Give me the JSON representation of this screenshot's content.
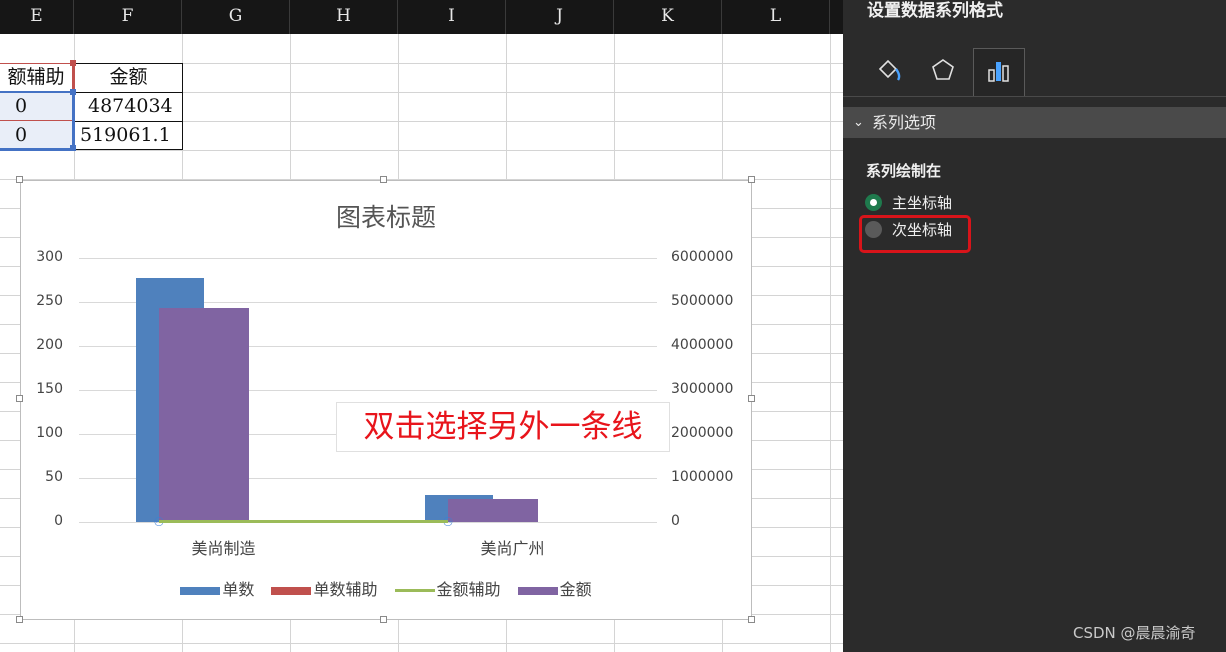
{
  "columns": [
    "E",
    "F",
    "G",
    "H",
    "I",
    "J",
    "K",
    "L"
  ],
  "table": {
    "headers": [
      "额辅助",
      "金额"
    ],
    "rows": [
      [
        "0",
        "4874034"
      ],
      [
        "0",
        "519061.1"
      ]
    ]
  },
  "chart": {
    "title": "图表标题",
    "annotation": "双击选择另外一条线"
  },
  "chart_data": {
    "type": "bar",
    "title": "图表标题",
    "categories": [
      "美尚制造",
      "美尚广州"
    ],
    "y_left": {
      "ticks": [
        "300",
        "250",
        "200",
        "150",
        "100",
        "50",
        "0"
      ],
      "range": [
        0,
        300
      ]
    },
    "y_right": {
      "ticks": [
        "6000000",
        "5000000",
        "4000000",
        "3000000",
        "2000000",
        "1000000",
        "0"
      ],
      "range": [
        0,
        6000000
      ]
    },
    "series": [
      {
        "name": "单数",
        "axis": "left",
        "values": [
          277,
          31
        ],
        "color": "#4f81bd"
      },
      {
        "name": "单数辅助",
        "axis": "left",
        "values": [
          0,
          0
        ],
        "color": "#c0504d"
      },
      {
        "name": "金额辅助",
        "axis": "left",
        "values": [
          0,
          0
        ],
        "color": "#9bbb59"
      },
      {
        "name": "金额",
        "axis": "right",
        "values": [
          4874034,
          519061.1
        ],
        "color": "#8064a2"
      }
    ],
    "legend": "bottom"
  },
  "panel": {
    "title": "设置数据系列格式",
    "section": "系列选项",
    "plot_on_label": "系列绘制在",
    "options": [
      {
        "label": "主坐标轴",
        "selected": true
      },
      {
        "label": "次坐标轴",
        "selected": false
      }
    ],
    "icons": [
      "fill-line-icon",
      "effects-icon",
      "series-options-icon"
    ]
  },
  "watermark": "CSDN @晨晨渝奇"
}
